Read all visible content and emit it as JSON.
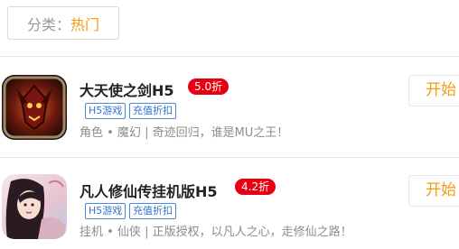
{
  "filter": {
    "label": "分类：",
    "value": "热门"
  },
  "games": [
    {
      "title": "大天使之剑H5",
      "discount": "5.0折",
      "tags": [
        "H5游戏",
        "充值折扣"
      ],
      "description": "角色 • 魔幻 | 奇迹回归，谁是MU之王！",
      "action_label": "开始"
    },
    {
      "title": "凡人修仙传挂机版H5",
      "discount": "4.2折",
      "tags": [
        "H5游戏",
        "充值折扣"
      ],
      "description": "挂机 • 仙侠 | 正版授权，以凡人之心，走修仙之路！",
      "action_label": "开始"
    }
  ],
  "colors": {
    "accent": "#f39c12",
    "discount": "#e60012",
    "tag": "#2f74cc"
  }
}
